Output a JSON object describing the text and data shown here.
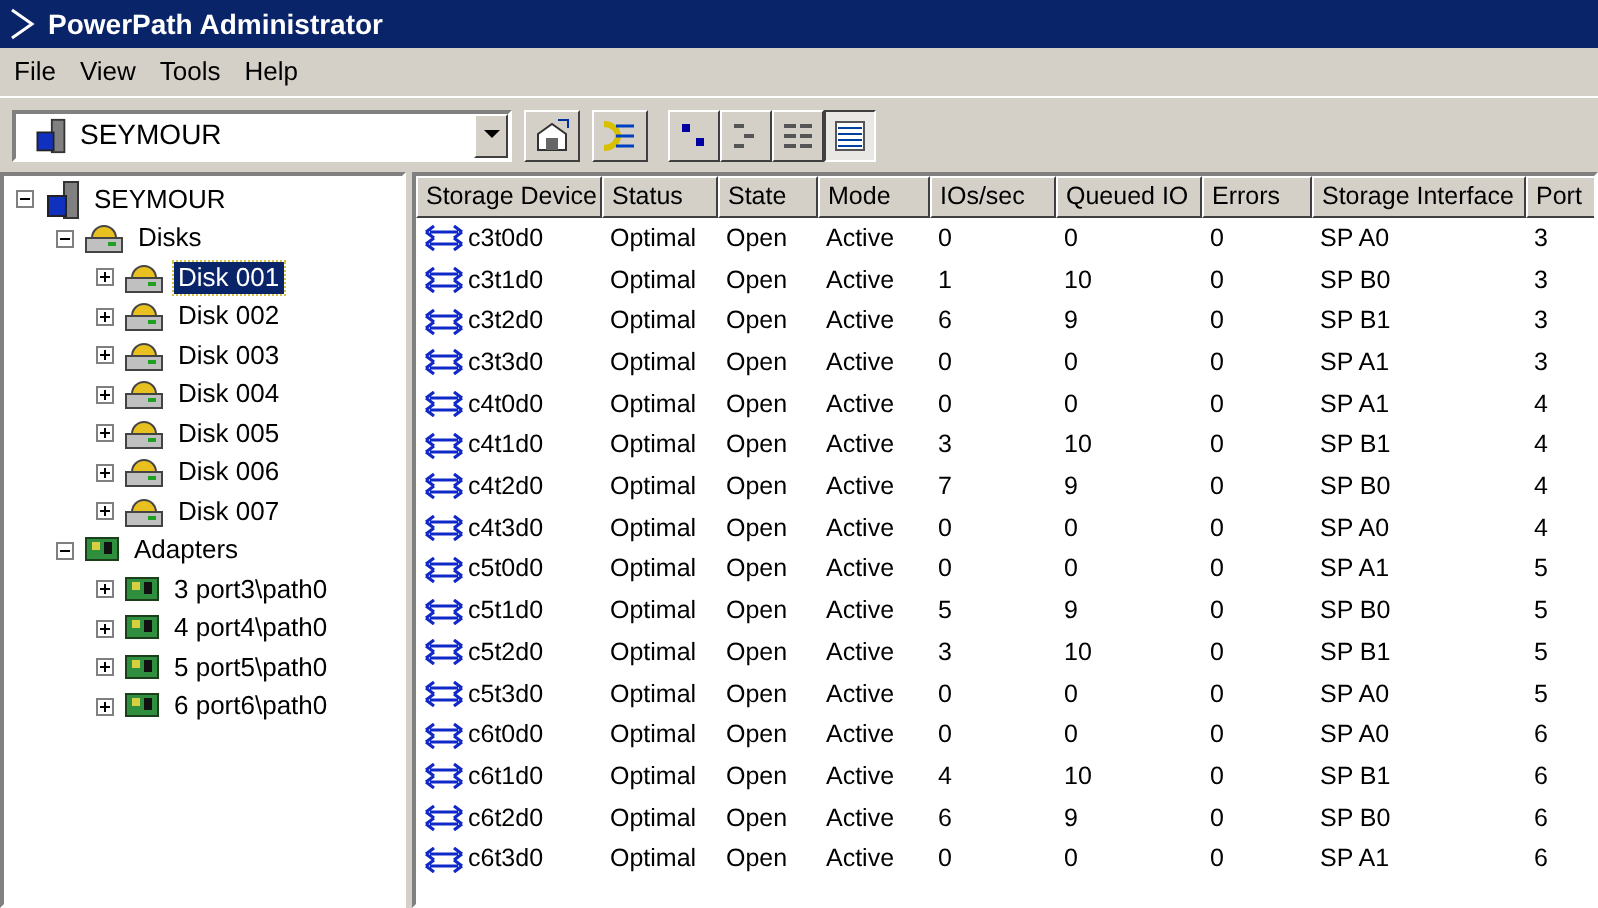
{
  "window": {
    "title": "PowerPath Administrator"
  },
  "menu": [
    "File",
    "View",
    "Tools",
    "Help"
  ],
  "toolbar": {
    "host_combo": {
      "value": "SEYMOUR"
    },
    "view_buttons": [
      {
        "selected": false
      },
      {
        "selected": false
      },
      {
        "selected": false
      },
      {
        "selected": true
      }
    ]
  },
  "tree": {
    "label": "SEYMOUR",
    "kind": "host",
    "expanded": true,
    "selected": false,
    "children": [
      {
        "label": "Disks",
        "kind": "disks",
        "expanded": true,
        "selected": false,
        "children": [
          {
            "label": "Disk 001",
            "kind": "disk",
            "expanded": false,
            "selected": true
          },
          {
            "label": "Disk 002",
            "kind": "disk",
            "expanded": false,
            "selected": false
          },
          {
            "label": "Disk 003",
            "kind": "disk",
            "expanded": false,
            "selected": false
          },
          {
            "label": "Disk 004",
            "kind": "disk",
            "expanded": false,
            "selected": false
          },
          {
            "label": "Disk 005",
            "kind": "disk",
            "expanded": false,
            "selected": false
          },
          {
            "label": "Disk 006",
            "kind": "disk",
            "expanded": false,
            "selected": false
          },
          {
            "label": "Disk 007",
            "kind": "disk",
            "expanded": false,
            "selected": false
          }
        ]
      },
      {
        "label": "Adapters",
        "kind": "adapters",
        "expanded": true,
        "selected": false,
        "children": [
          {
            "label": "3 port3\\path0",
            "kind": "adapter",
            "expanded": false,
            "selected": false
          },
          {
            "label": "4 port4\\path0",
            "kind": "adapter",
            "expanded": false,
            "selected": false
          },
          {
            "label": "5 port5\\path0",
            "kind": "adapter",
            "expanded": false,
            "selected": false
          },
          {
            "label": "6 port6\\path0",
            "kind": "adapter",
            "expanded": false,
            "selected": false
          }
        ]
      }
    ]
  },
  "table": {
    "columns": [
      "Storage Device",
      "Status",
      "State",
      "Mode",
      "IOs/sec",
      "Queued IO",
      "Errors",
      "Storage Interface",
      "Port"
    ],
    "rows": [
      [
        "c3t0d0",
        "Optimal",
        "Open",
        "Active",
        "0",
        "0",
        "0",
        "SP A0",
        "3"
      ],
      [
        "c3t1d0",
        "Optimal",
        "Open",
        "Active",
        "1",
        "10",
        "0",
        "SP B0",
        "3"
      ],
      [
        "c3t2d0",
        "Optimal",
        "Open",
        "Active",
        "6",
        "9",
        "0",
        "SP B1",
        "3"
      ],
      [
        "c3t3d0",
        "Optimal",
        "Open",
        "Active",
        "0",
        "0",
        "0",
        "SP A1",
        "3"
      ],
      [
        "c4t0d0",
        "Optimal",
        "Open",
        "Active",
        "0",
        "0",
        "0",
        "SP A1",
        "4"
      ],
      [
        "c4t1d0",
        "Optimal",
        "Open",
        "Active",
        "3",
        "10",
        "0",
        "SP B1",
        "4"
      ],
      [
        "c4t2d0",
        "Optimal",
        "Open",
        "Active",
        "7",
        "9",
        "0",
        "SP B0",
        "4"
      ],
      [
        "c4t3d0",
        "Optimal",
        "Open",
        "Active",
        "0",
        "0",
        "0",
        "SP A0",
        "4"
      ],
      [
        "c5t0d0",
        "Optimal",
        "Open",
        "Active",
        "0",
        "0",
        "0",
        "SP A1",
        "5"
      ],
      [
        "c5t1d0",
        "Optimal",
        "Open",
        "Active",
        "5",
        "9",
        "0",
        "SP B0",
        "5"
      ],
      [
        "c5t2d0",
        "Optimal",
        "Open",
        "Active",
        "3",
        "10",
        "0",
        "SP B1",
        "5"
      ],
      [
        "c5t3d0",
        "Optimal",
        "Open",
        "Active",
        "0",
        "0",
        "0",
        "SP A0",
        "5"
      ],
      [
        "c6t0d0",
        "Optimal",
        "Open",
        "Active",
        "0",
        "0",
        "0",
        "SP A0",
        "6"
      ],
      [
        "c6t1d0",
        "Optimal",
        "Open",
        "Active",
        "4",
        "10",
        "0",
        "SP B1",
        "6"
      ],
      [
        "c6t2d0",
        "Optimal",
        "Open",
        "Active",
        "6",
        "9",
        "0",
        "SP B0",
        "6"
      ],
      [
        "c6t3d0",
        "Optimal",
        "Open",
        "Active",
        "0",
        "0",
        "0",
        "SP A1",
        "6"
      ]
    ]
  }
}
